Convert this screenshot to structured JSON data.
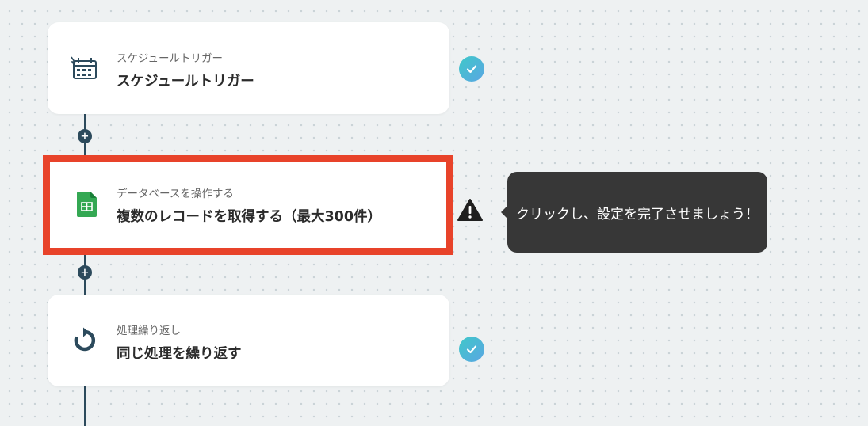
{
  "flow": {
    "steps": [
      {
        "sub": "スケジュールトリガー",
        "title": "スケジュールトリガー",
        "icon": "schedule-trigger-icon",
        "status": "check-icon"
      },
      {
        "sub": "データベースを操作する",
        "title": "複数のレコードを取得する（最大300件）",
        "icon": "google-sheets-icon",
        "status": "warning-icon",
        "highlight_color": "#e8432a"
      },
      {
        "sub": "処理繰り返し",
        "title": "同じ処理を繰り返す",
        "icon": "loop-icon",
        "status": "check-icon"
      }
    ],
    "add_step_label": "+"
  },
  "tooltip": {
    "text": "クリックし、設定を完了させましょう！"
  },
  "colors": {
    "accent_red": "#e8432a",
    "connector": "#2c4a5c",
    "tooltip_bg": "#373737",
    "sheets_green": "#34a853"
  }
}
